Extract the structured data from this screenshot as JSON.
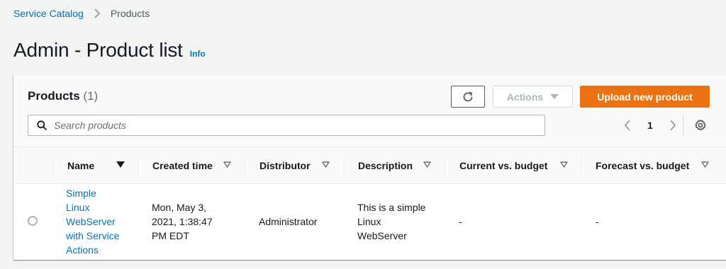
{
  "breadcrumb": {
    "parent": "Service Catalog",
    "current": "Products"
  },
  "page": {
    "title": "Admin - Product list",
    "info": "Info"
  },
  "panel": {
    "title": "Products",
    "count": "(1)",
    "actions_label": "Actions",
    "upload_label": "Upload new product"
  },
  "search": {
    "placeholder": "Search products",
    "value": ""
  },
  "pagination": {
    "current_page": "1"
  },
  "table": {
    "columns": [
      {
        "label": "Name"
      },
      {
        "label": "Created time"
      },
      {
        "label": "Distributor"
      },
      {
        "label": "Description"
      },
      {
        "label": "Current vs. budget"
      },
      {
        "label": "Forecast vs. budget"
      }
    ],
    "rows": [
      {
        "name_lines": [
          "Simple",
          "Linux",
          "WebServer",
          "with Service",
          "Actions"
        ],
        "created_lines": [
          "Mon, May 3,",
          "2021, 1:38:47",
          "PM EDT"
        ],
        "distributor": "Administrator",
        "description_lines": [
          "This is a simple",
          "Linux",
          "WebServer"
        ],
        "current_vs_budget": "-",
        "forecast_vs_budget": "-",
        "selected": false
      }
    ]
  },
  "colors": {
    "link": "#0073bb",
    "primary_button": "#ec7211",
    "page_bg": "#f2f3f3"
  }
}
